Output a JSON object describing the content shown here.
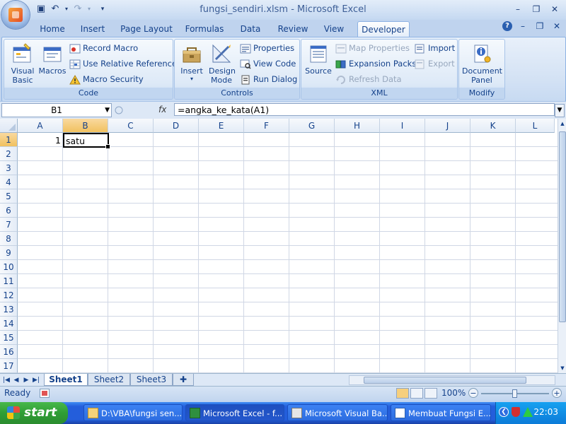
{
  "window": {
    "title": "fungsi_sendiri.xlsm - Microsoft Excel",
    "minimize": "–",
    "restore": "❐",
    "close": "✕"
  },
  "mdi": {
    "help": "?",
    "minimize": "–",
    "restore": "❐",
    "close": "✕"
  },
  "ribbon_tabs": [
    "Home",
    "Insert",
    "Page Layout",
    "Formulas",
    "Data",
    "Review",
    "View",
    "Developer"
  ],
  "groups": {
    "code": {
      "label": "Code",
      "visual_basic": "Visual Basic",
      "macros": "Macros",
      "record_macro": "Record Macro",
      "relative_refs": "Use Relative References",
      "macro_security": "Macro Security"
    },
    "controls": {
      "label": "Controls",
      "insert": "Insert",
      "design_mode": "Design Mode",
      "properties": "Properties",
      "view_code": "View Code",
      "run_dialog": "Run Dialog"
    },
    "xml": {
      "label": "XML",
      "source": "Source",
      "map_properties": "Map Properties",
      "expansion_packs": "Expansion Packs",
      "refresh_data": "Refresh Data",
      "import": "Import",
      "export": "Export"
    },
    "modify": {
      "label": "Modify",
      "document_panel": "Document Panel"
    }
  },
  "formula_bar": {
    "name_box": "B1",
    "fx": "fx",
    "formula": "=angka_ke_kata(A1)"
  },
  "columns": [
    "A",
    "B",
    "C",
    "D",
    "E",
    "F",
    "G",
    "H",
    "I",
    "J",
    "K",
    "L"
  ],
  "rows": [
    "1",
    "2",
    "3",
    "4",
    "5",
    "6",
    "7",
    "8",
    "9",
    "10",
    "11",
    "12",
    "13",
    "14",
    "15",
    "16",
    "17"
  ],
  "cells": {
    "A1": "1",
    "B1": "satu"
  },
  "sheets": [
    "Sheet1",
    "Sheet2",
    "Sheet3"
  ],
  "status": {
    "ready": "Ready",
    "zoom": "100%"
  },
  "taskbar": {
    "start": "start",
    "tasks": [
      "D:\\VBA\\fungsi sen...",
      "Microsoft Excel - f...",
      "Microsoft Visual Ba...",
      "Membuat Fungsi E..."
    ],
    "clock": "22:03"
  }
}
